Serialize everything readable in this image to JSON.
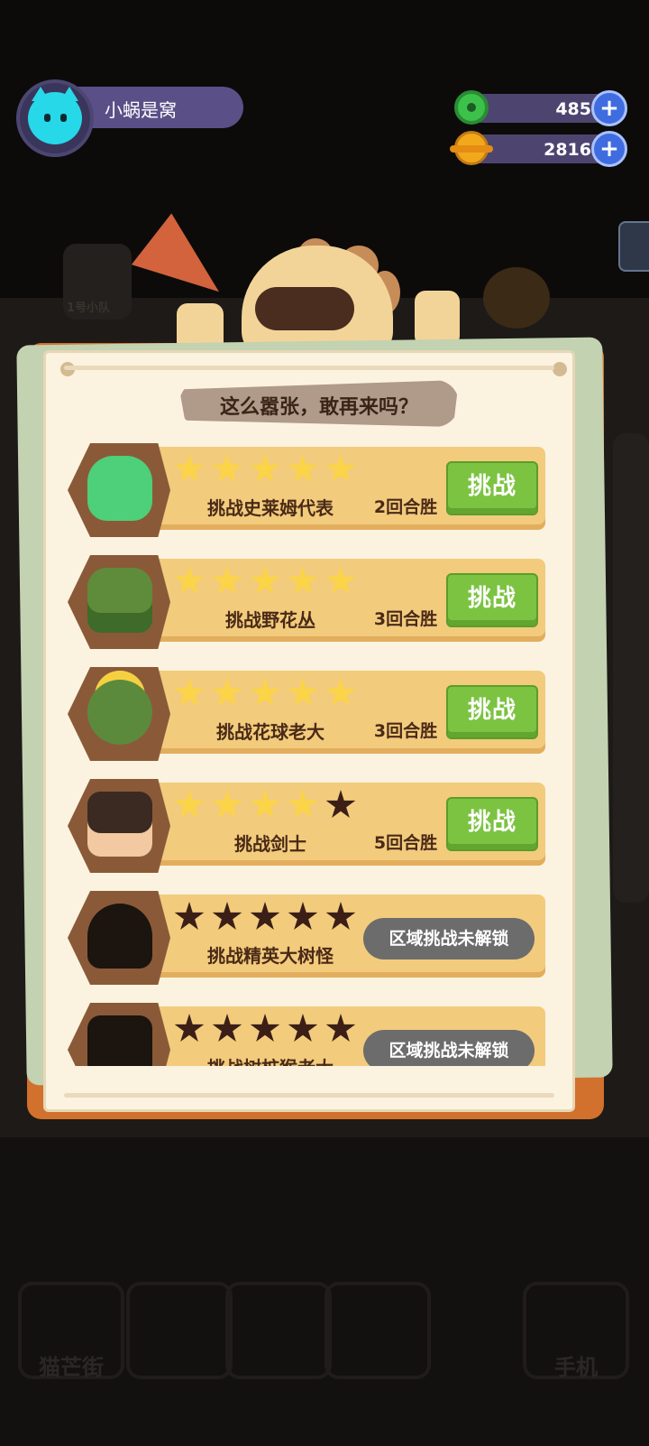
{
  "player": {
    "name": "小蜗是窝"
  },
  "resources": [
    {
      "icon": "donut-gem-icon",
      "value": "485",
      "color": "#3cc24a"
    },
    {
      "icon": "gold-planet-coin-icon",
      "value": "2816",
      "color": "#f2a81b"
    }
  ],
  "background": {
    "squad_label": "1号小队",
    "nav_left": "猫芒街",
    "nav_right": "手机"
  },
  "panel": {
    "title": "这么嚣张，敢再来吗？",
    "challenge_label": "挑战",
    "locked_label": "区域挑战未解锁",
    "challenges": [
      {
        "name": "挑战史莱姆代表",
        "rounds": "2回合胜",
        "stars": 5,
        "max_stars": 5,
        "unlocked": true,
        "portrait": "slime-icon"
      },
      {
        "name": "挑战野花丛",
        "rounds": "3回合胜",
        "stars": 5,
        "max_stars": 5,
        "unlocked": true,
        "portrait": "wildflower-bush-icon"
      },
      {
        "name": "挑战花球老大",
        "rounds": "3回合胜",
        "stars": 5,
        "max_stars": 5,
        "unlocked": true,
        "portrait": "flower-ball-boss-icon"
      },
      {
        "name": "挑战剑士",
        "rounds": "5回合胜",
        "stars": 4,
        "max_stars": 5,
        "unlocked": true,
        "portrait": "swordsman-icon"
      },
      {
        "name": "挑战精英大树怪",
        "rounds": "",
        "stars": 0,
        "max_stars": 5,
        "unlocked": false,
        "portrait": "elite-tree-monster-icon"
      },
      {
        "name": "挑战树桩猴老大",
        "rounds": "",
        "stars": 0,
        "max_stars": 5,
        "unlocked": false,
        "portrait": "stump-monkey-boss-icon"
      }
    ]
  }
}
